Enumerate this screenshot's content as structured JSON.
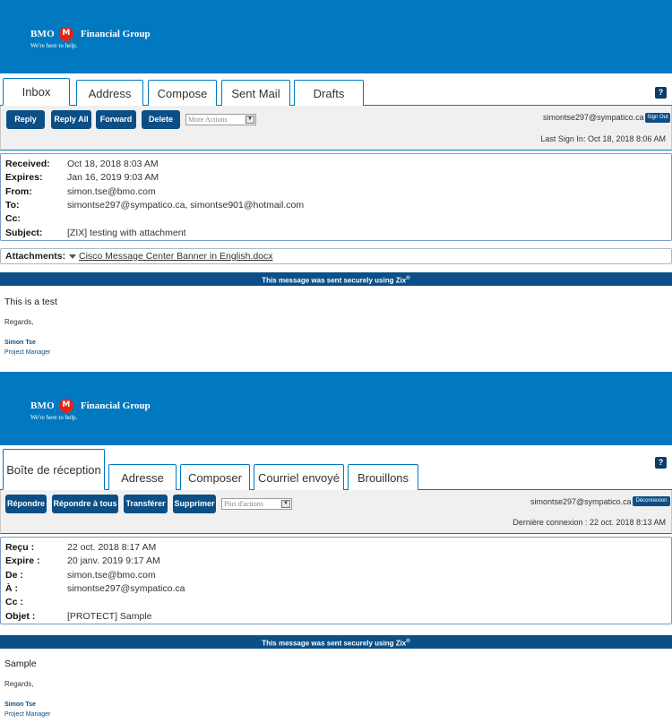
{
  "colors": {
    "brand": "#0079c1",
    "button": "#0b4f86",
    "logo_red": "#e2231a"
  },
  "panels": [
    {
      "logo": {
        "brand": "BMO",
        "group": "Financial Group",
        "tagline": "We're here to help."
      },
      "tabs": [
        "Inbox",
        "Address",
        "Compose",
        "Sent Mail",
        "Drafts"
      ],
      "help_label": "?",
      "buttons": [
        "Reply",
        "Reply All",
        "Forward",
        "Delete"
      ],
      "more_actions": "More Actions",
      "account_email": "simontse297@sympatico.ca",
      "signout_label": "Sign Out",
      "last_sign_in": "Last Sign In: Oct 18, 2018 8:06 AM",
      "headers": {
        "received_label": "Received:",
        "received": "Oct 18, 2018 8:03 AM",
        "expires_label": "Expires:",
        "expires": "Jan 16, 2019 9:03 AM",
        "from_label": "From:",
        "from": "simon.tse@bmo.com",
        "to_label": "To:",
        "to": "simontse297@sympatico.ca, simontse901@hotmail.com",
        "cc_label": "Cc:",
        "cc": "",
        "subject_label": "Subject:",
        "subject": "[ZIX] testing with attachment"
      },
      "attachments_label": "Attachments:",
      "attachment_file": "Cisco Message Center Banner in English.docx",
      "secure_text": "This message was sent securely using Zix",
      "secure_mark": "®",
      "body": "This is a test",
      "regards": "Regards,",
      "sig_name": "Simon Tse",
      "sig_title": "Project Manager"
    },
    {
      "logo": {
        "brand": "BMO",
        "group": "Financial Group",
        "tagline": "We're here to help."
      },
      "tabs": [
        "Boîte de réception",
        "Adresse",
        "Composer",
        "Courriel envoyé",
        "Brouillons"
      ],
      "help_label": "?",
      "buttons": [
        "Répondre",
        "Répondre à tous",
        "Transférer",
        "Supprimer"
      ],
      "more_actions": "Plus d'actions",
      "account_email": "simontse297@sympatico.ca",
      "signout_label": "Déconnexion",
      "last_sign_in": "Dernière connexion : 22 oct. 2018 8:13 AM",
      "headers": {
        "received_label": "Reçu :",
        "received": "22 oct. 2018 8:17 AM",
        "expires_label": "Expire :",
        "expires": "20 janv. 2019 9:17 AM",
        "from_label": "De :",
        "from": "simon.tse@bmo.com",
        "to_label": "À :",
        "to": "simontse297@sympatico.ca",
        "cc_label": "Cc :",
        "cc": "",
        "subject_label": "Objet :",
        "subject": "[PROTECT] Sample"
      },
      "secure_text": "This message was sent securely using Zix",
      "secure_mark": "®",
      "body": "Sample",
      "regards": "Regards,",
      "sig_name": "Simon Tse",
      "sig_title": "Project Manager"
    }
  ]
}
